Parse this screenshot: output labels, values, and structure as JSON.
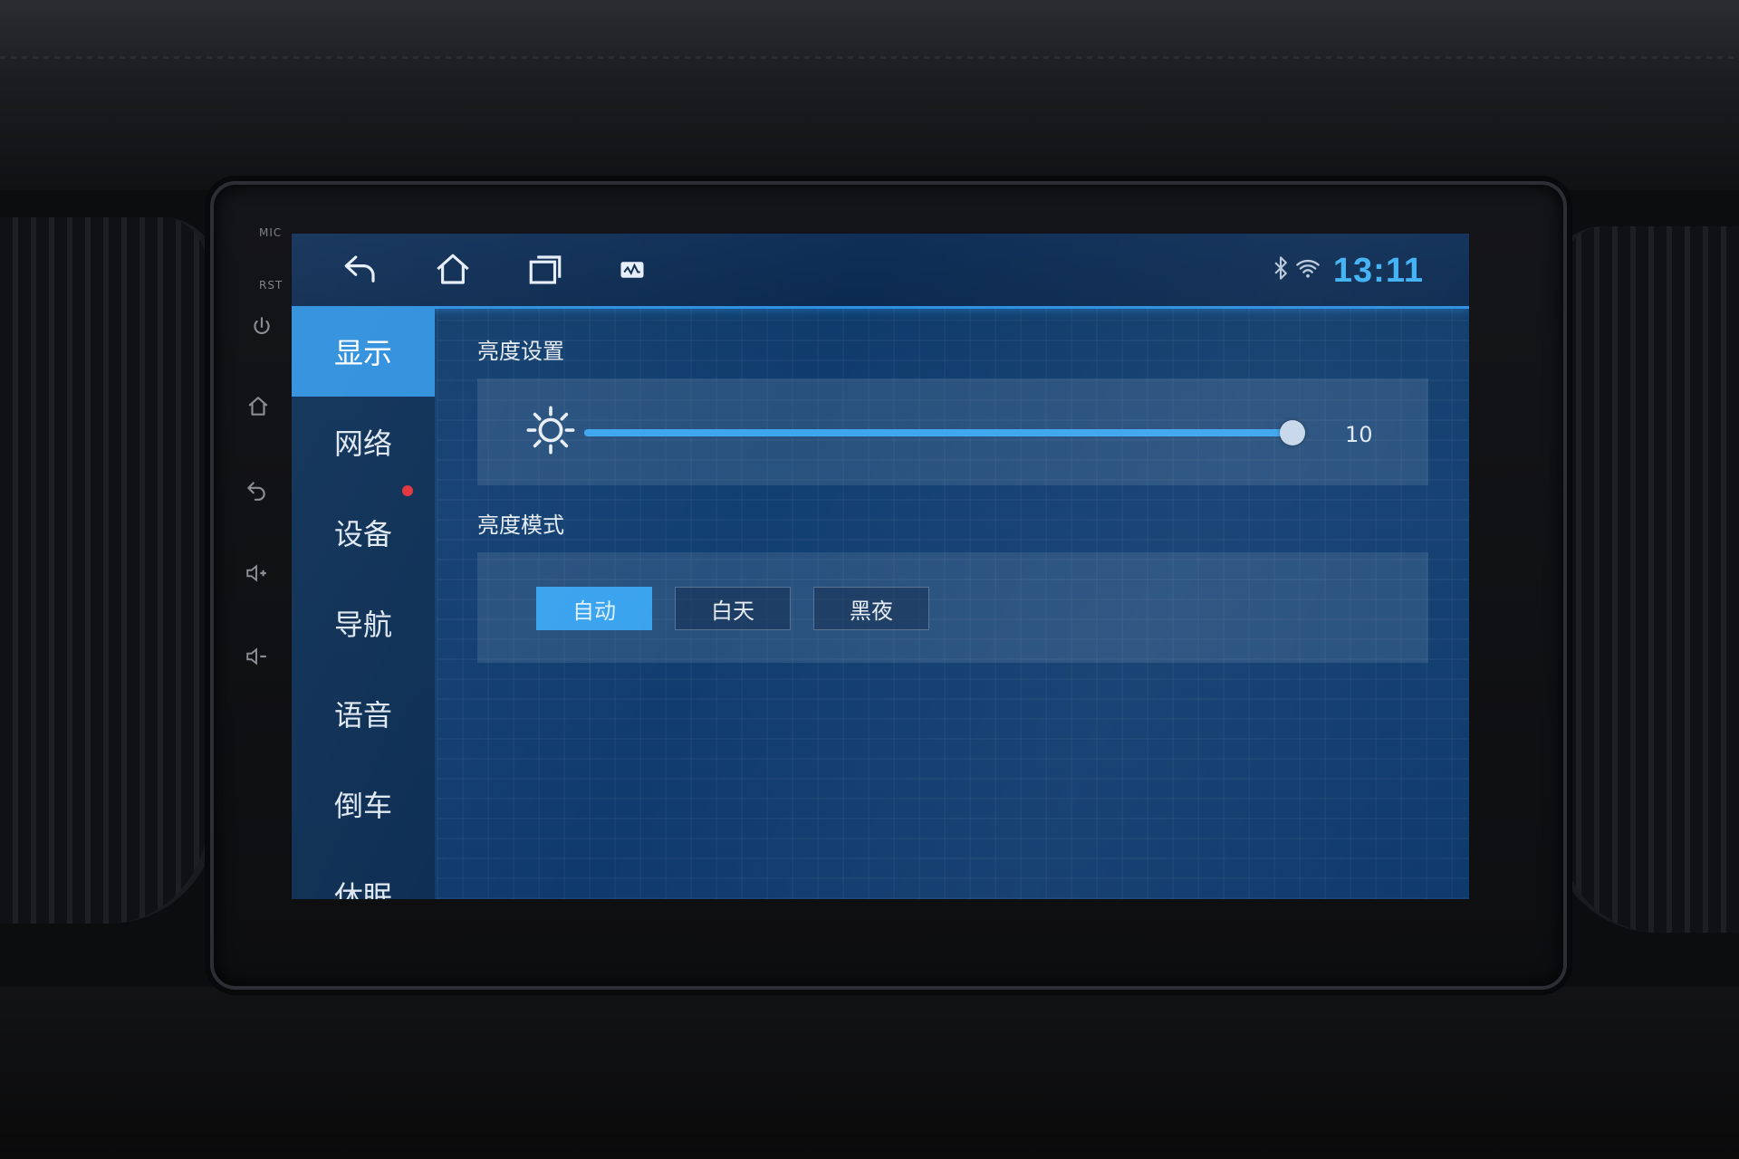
{
  "bezel": {
    "mic_label": "MIC",
    "rst_label": "RST",
    "buttons": [
      {
        "icon": "power-icon"
      },
      {
        "icon": "home-icon"
      },
      {
        "icon": "back-icon"
      },
      {
        "icon": "volume-up-icon"
      },
      {
        "icon": "volume-down-icon"
      }
    ]
  },
  "topbar": {
    "nav_icons": [
      "back-icon",
      "home-icon",
      "recent-apps-icon",
      "screenshot-icon"
    ],
    "status_icons": [
      "bluetooth-icon",
      "wifi-icon"
    ],
    "time": "13:11",
    "accent_color": "#3fb1f5"
  },
  "sidebar": {
    "items": [
      {
        "label": "显示",
        "active": true
      },
      {
        "label": "网络",
        "active": false
      },
      {
        "label": "设备",
        "active": false,
        "notification_dot": true
      },
      {
        "label": "导航",
        "active": false
      },
      {
        "label": "语音",
        "active": false
      },
      {
        "label": "倒车",
        "active": false
      },
      {
        "label": "休眠",
        "active": false
      }
    ],
    "active_color": "#2f8fdc"
  },
  "brightness": {
    "title": "亮度设置",
    "icon": "brightness-sun-icon",
    "value": "10",
    "level_fraction": 1.0
  },
  "brightness_mode": {
    "title": "亮度模式",
    "options": [
      {
        "label": "自动",
        "selected": true
      },
      {
        "label": "白天",
        "selected": false
      },
      {
        "label": "黑夜",
        "selected": false
      }
    ]
  }
}
